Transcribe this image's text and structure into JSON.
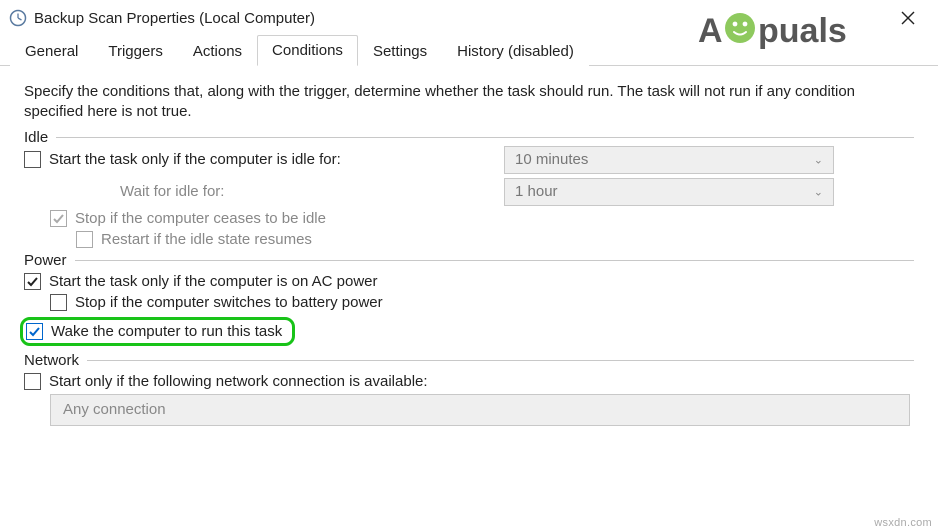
{
  "window": {
    "title": "Backup Scan Properties (Local Computer)"
  },
  "tabs": {
    "general": "General",
    "triggers": "Triggers",
    "actions": "Actions",
    "conditions": "Conditions",
    "settings": "Settings",
    "history": "History (disabled)"
  },
  "intro": "Specify the conditions that, along with the trigger, determine whether the task should run.  The task will not run  if any condition specified here is not true.",
  "idle": {
    "group": "Idle",
    "start_only_idle": "Start the task only if the computer is idle for:",
    "idle_duration": "10 minutes",
    "wait_label": "Wait for idle for:",
    "wait_duration": "1 hour",
    "stop_cease": "Stop if the computer ceases to be idle",
    "restart_resume": "Restart if the idle state resumes"
  },
  "power": {
    "group": "Power",
    "ac_only": "Start the task only if the computer is on AC power",
    "stop_battery": "Stop if the computer switches to battery power",
    "wake": "Wake the computer to run this task"
  },
  "network": {
    "group": "Network",
    "start_only": "Start only if the following network connection is available:",
    "connection": "Any connection"
  },
  "branding": {
    "logo_text": "A  puals",
    "watermark": "wsxdn.com"
  }
}
